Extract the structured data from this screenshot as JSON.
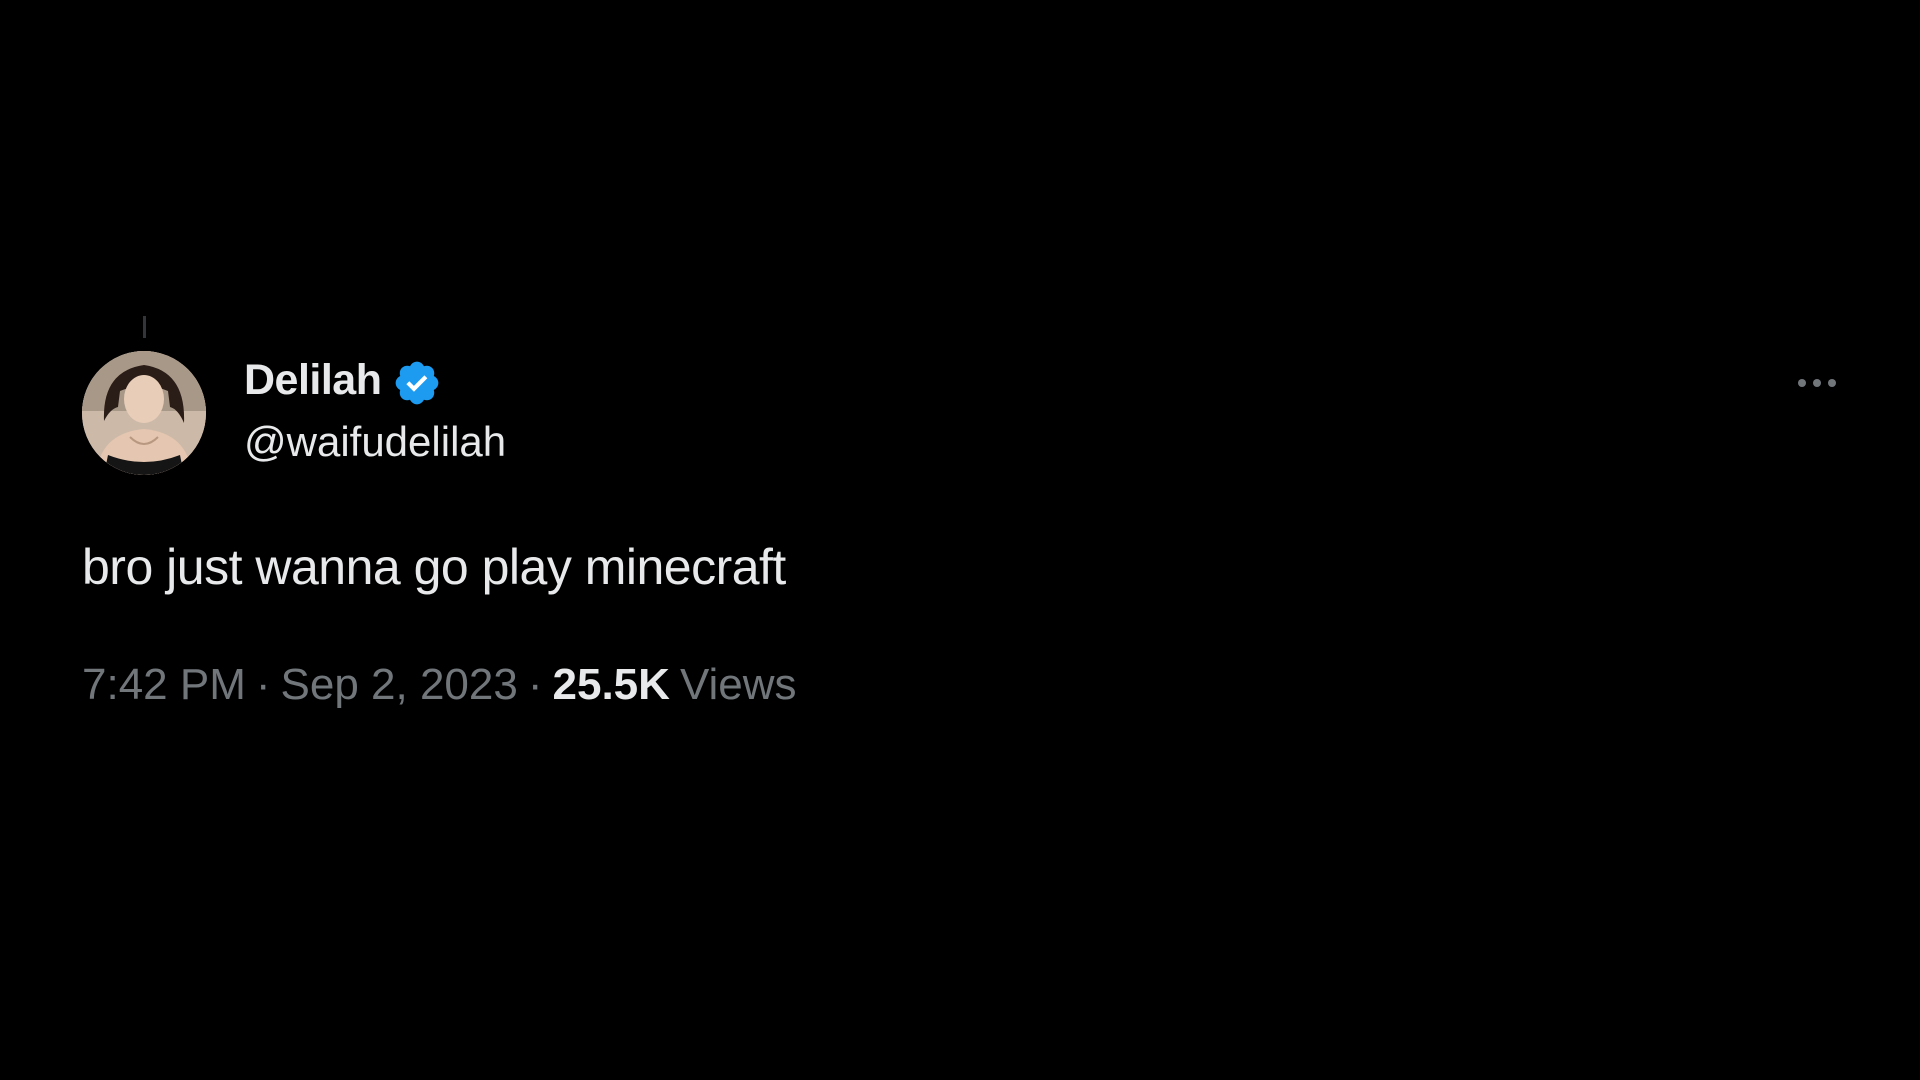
{
  "tweet": {
    "author": {
      "display_name": "Delilah",
      "handle": "@waifudelilah",
      "verified": true,
      "verified_icon": "verified-badge-icon",
      "avatar": "avatar"
    },
    "text": "bro just wanna go play minecraft",
    "time": "7:42 PM",
    "date": "Sep 2, 2023",
    "separator": "·",
    "views_count": "25.5K",
    "views_label": "Views",
    "more_icon": "more-icon"
  },
  "colors": {
    "background": "#000000",
    "primary_text": "#e7e9ea",
    "secondary_text": "#71767b",
    "verified_blue": "#1d9bf0"
  }
}
